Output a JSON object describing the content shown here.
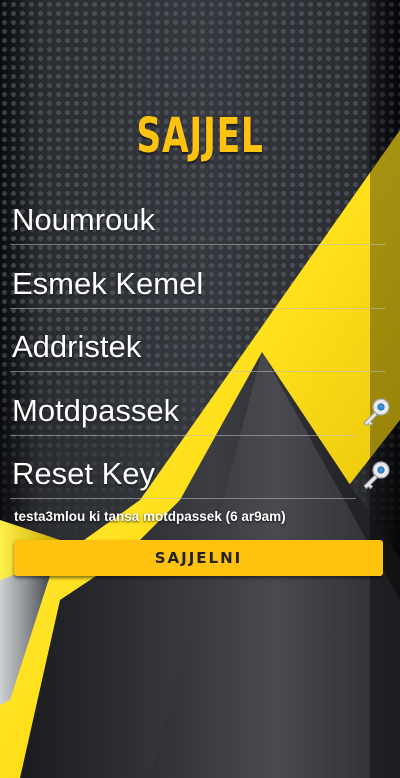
{
  "app": {
    "title": "SAJJEL"
  },
  "form": {
    "fields": [
      {
        "label": "Noumrouk",
        "icon": null
      },
      {
        "label": "Esmek Kemel",
        "icon": null
      },
      {
        "label": "Addristek",
        "icon": null
      },
      {
        "label": "Motdpassek",
        "icon": "key-icon"
      },
      {
        "label": "Reset Key",
        "icon": "key-icon"
      }
    ],
    "password_hint": "testa3mlou ki tansa motdpassek (6 ar9am)",
    "submit_label": "SAJJELNI"
  },
  "colors": {
    "accent": "#ffc20e",
    "background": "#2a2c30",
    "text": "#ffffff"
  }
}
